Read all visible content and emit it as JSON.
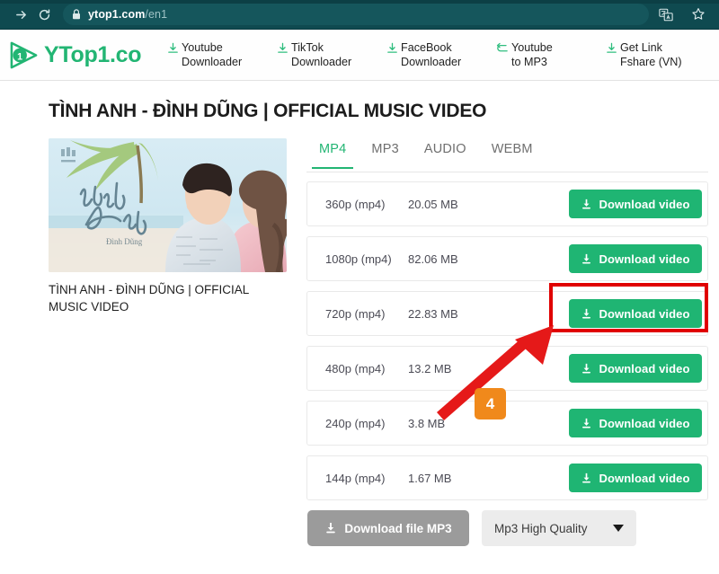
{
  "browser": {
    "url_host": "ytop1.com",
    "url_path": "/en1",
    "back_icon": "forward-arrow-icon",
    "reload_icon": "reload-icon",
    "lock_icon": "lock-icon",
    "translate_icon": "translate-icon",
    "bookmark_icon": "star-icon",
    "chrome_bg": "#0f4a50"
  },
  "site": {
    "logo_text": "YTop1.co",
    "logo_digit": "1",
    "accent": "#22b573",
    "nav": [
      {
        "icon": "download-icon",
        "label": "Youtube\nDownloader"
      },
      {
        "icon": "download-icon",
        "label": "TikTok\nDownloader"
      },
      {
        "icon": "download-icon",
        "label": "FaceBook\nDownloader"
      },
      {
        "icon": "convert-arrow-icon",
        "label": "Youtube\nto MP3"
      },
      {
        "icon": "download-icon",
        "label": "Get Link\nFshare (VN)"
      }
    ]
  },
  "page": {
    "title": "TÌNH ANH - ĐÌNH DŨNG | OFFICIAL MUSIC VIDEO",
    "thumbnail_caption": "TÌNH ANH - ĐÌNH DŨNG | OFFICIAL MUSIC VIDEO",
    "thumbnail_overlay_title": "tình Anh",
    "thumbnail_overlay_artist": "Đình Dũng"
  },
  "tabs": [
    {
      "label": "MP4",
      "active": true
    },
    {
      "label": "MP3",
      "active": false
    },
    {
      "label": "AUDIO",
      "active": false
    },
    {
      "label": "WEBM",
      "active": false
    }
  ],
  "downloads": {
    "button_label": "Download video",
    "button_icon": "download-icon",
    "rows": [
      {
        "quality": "360p (mp4)",
        "size": "20.05 MB",
        "highlighted": false
      },
      {
        "quality": "1080p (mp4)",
        "size": "82.06 MB",
        "highlighted": true
      },
      {
        "quality": "720p (mp4)",
        "size": "22.83 MB",
        "highlighted": false
      },
      {
        "quality": "480p (mp4)",
        "size": "13.2 MB",
        "highlighted": false
      },
      {
        "quality": "240p (mp4)",
        "size": "3.8 MB",
        "highlighted": false
      },
      {
        "quality": "144p (mp4)",
        "size": "1.67 MB",
        "highlighted": false
      }
    ]
  },
  "bottom": {
    "mp3_button_label": "Download file MP3",
    "mp3_button_icon": "download-icon",
    "quality_select_value": "Mp3 High Quality",
    "quality_select_caret": "chevron-down-icon"
  },
  "annotations": {
    "step_badge": "4",
    "badge_color": "#f0891b",
    "highlight_color": "#e00000",
    "arrow_color": "#e51919"
  }
}
